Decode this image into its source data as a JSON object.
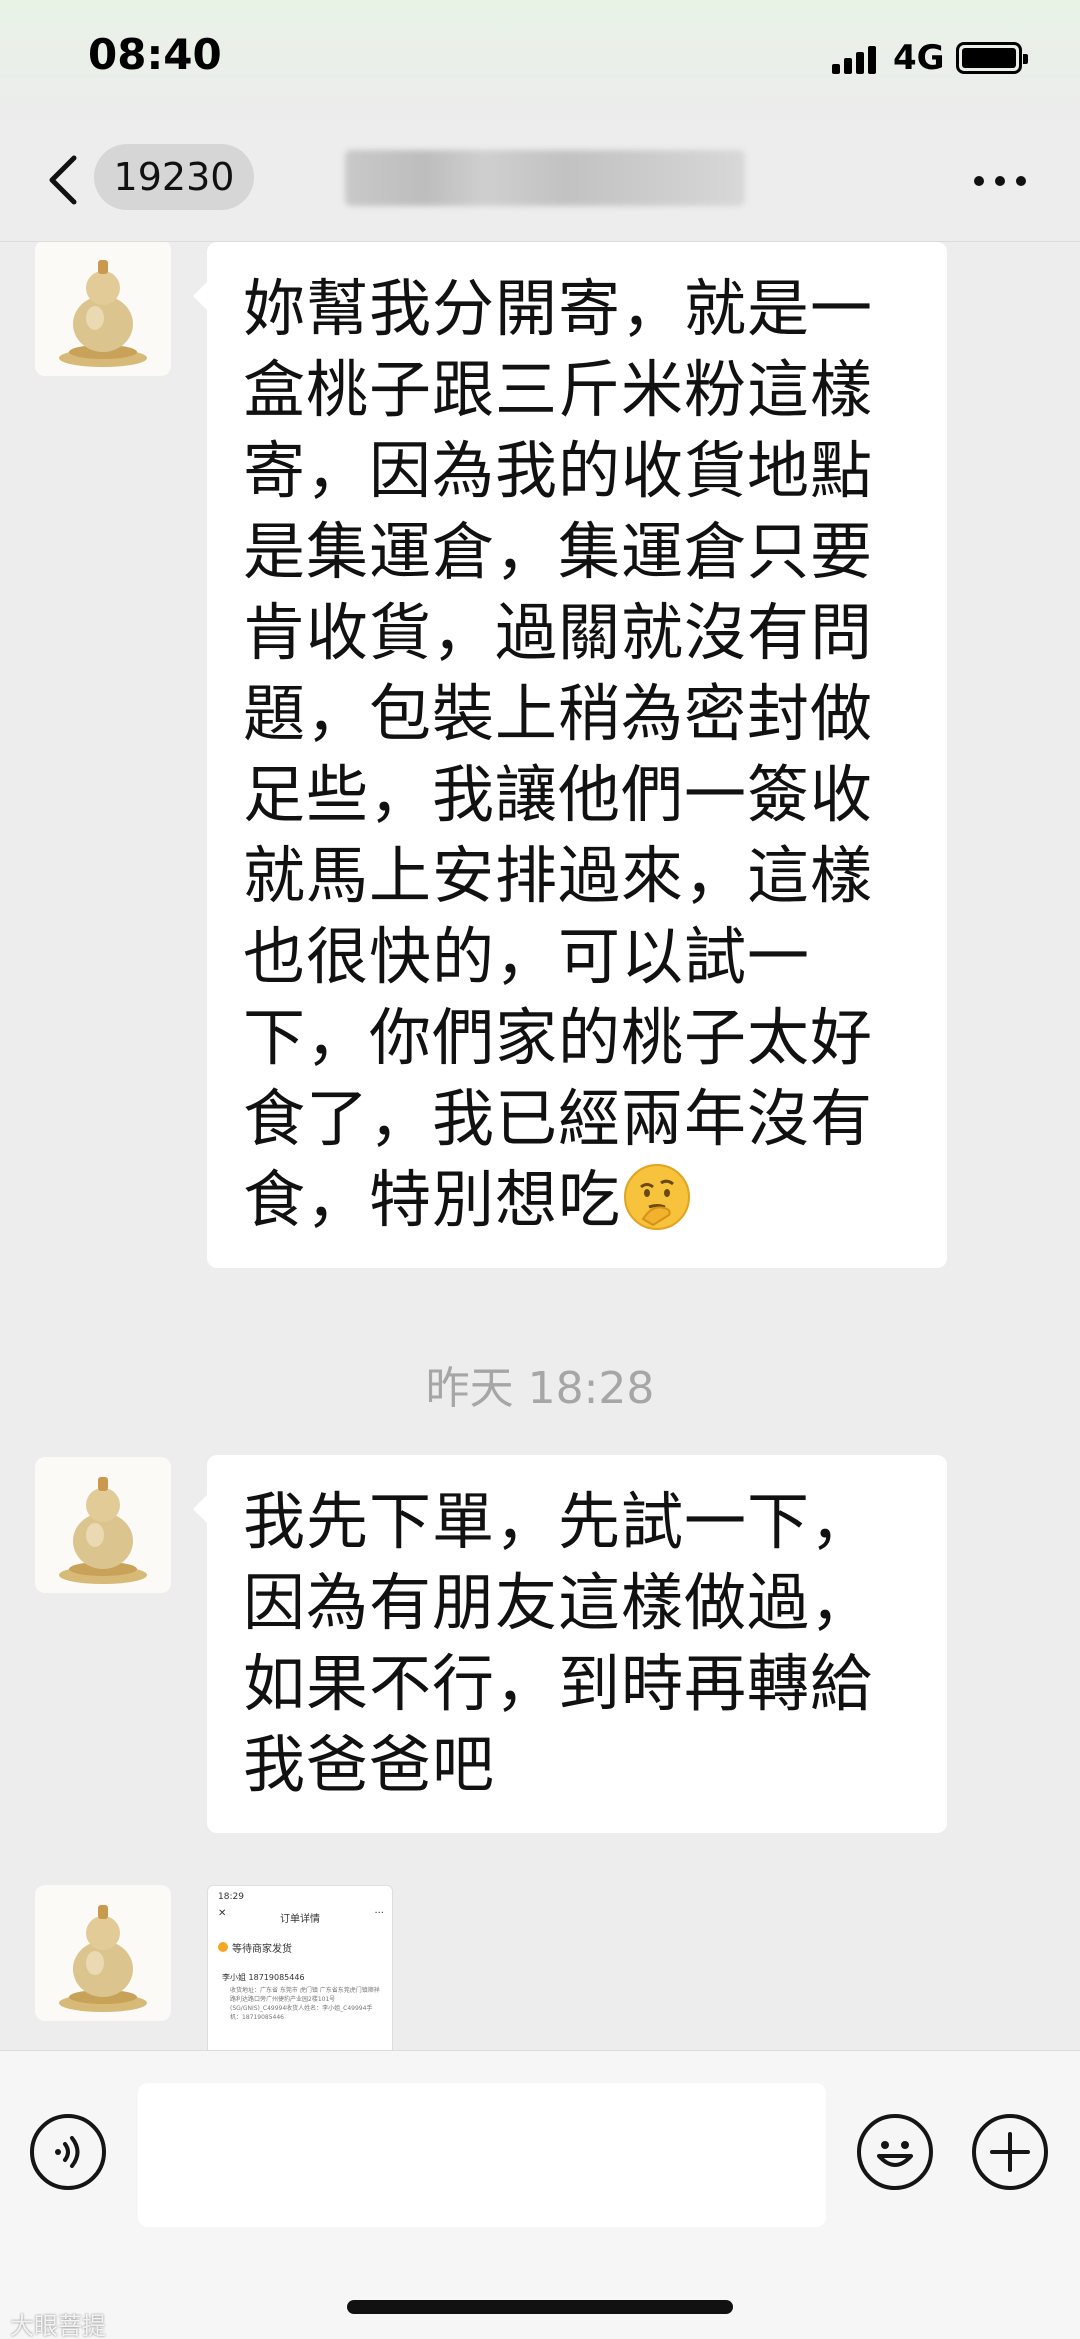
{
  "status_bar": {
    "time": "08:40",
    "network": "4G"
  },
  "nav": {
    "unread_count": "19230",
    "contact_name": "",
    "more_icon": "ellipsis-icon",
    "back_icon": "chevron-left-icon"
  },
  "messages": [
    {
      "sender": "contact",
      "text": "妳幫我分開寄，就是一盒桃子跟三斤米粉這樣寄，因為我的收貨地點是集運倉，集運倉只要肯收貨，過關就沒有問題，包裝上稍為密封做足些，我讓他們一簽收就馬上安排過來，這樣也很快的，可以試一下，你們家的桃子太好食了，我已經兩年沒有食，特別想吃",
      "trailing_emoji": "thinking-face-emoji"
    },
    {
      "type": "timestamp",
      "text": "昨天 18:28"
    },
    {
      "sender": "contact",
      "text": "我先下單，先試一下，因為有朋友這樣做過，如果不行，到時再轉給我爸爸吧"
    },
    {
      "sender": "contact",
      "type": "image",
      "image_content": {
        "time": "18:29",
        "title": "订单详情",
        "status": "等待商家发货",
        "name": "李小姐 18719085446",
        "address": "收货地址：广东省 东莞市 虎门镇 广东省东莞虎门镇顺祥路利达路口旁广州捷豹产业园2楼101号(SG/GNIS)_C49994收货人姓名：李小姐_C49994手机：18719085446"
      }
    }
  ],
  "input_bar": {
    "voice_icon": "voice-icon",
    "emoji_icon": "smiley-icon",
    "plus_icon": "plus-icon",
    "input_value": ""
  },
  "watermark": "大眼菩提",
  "colors": {
    "background": "#ededed",
    "bubble": "#ffffff",
    "timestamp": "#a6a6a6"
  }
}
